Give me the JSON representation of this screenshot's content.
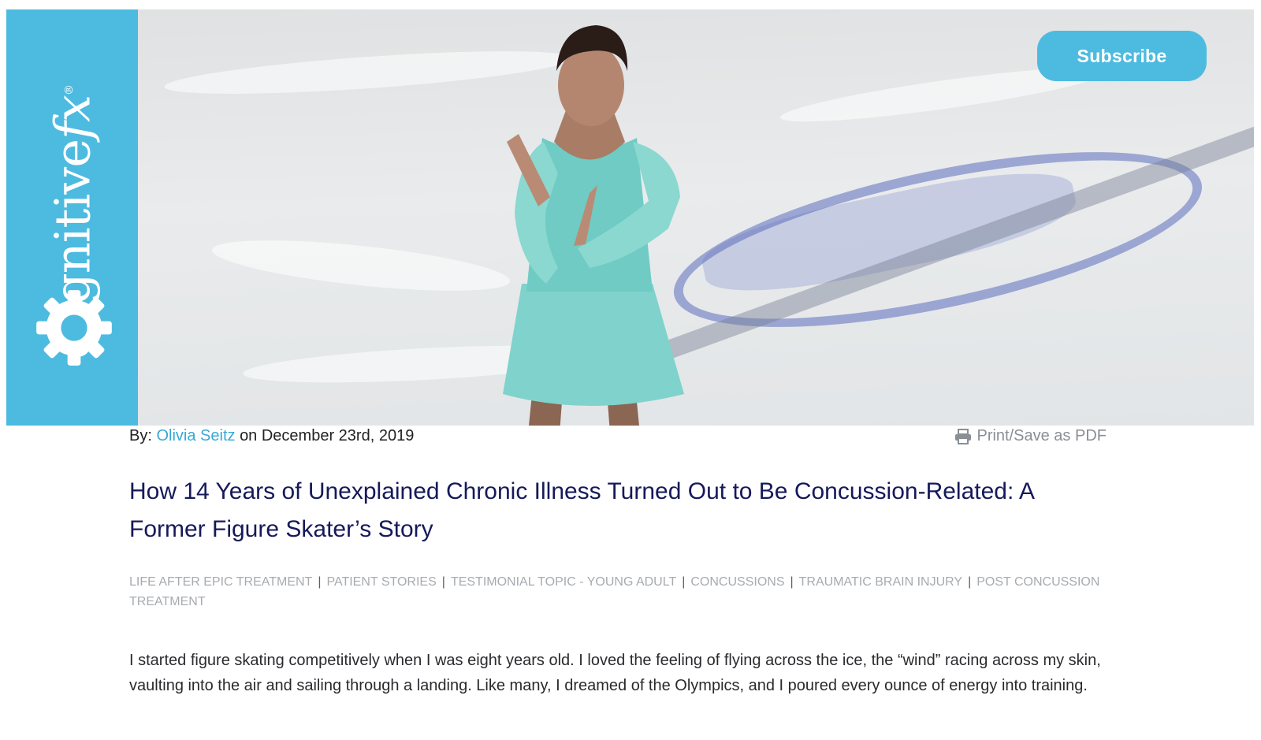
{
  "brand": {
    "logo_text_main": "cognitive",
    "logo_text_fx": "fx",
    "logo_mark": "®",
    "logo_icon": "gear-icon",
    "accent_color": "#4dbbe0",
    "title_color": "#16195a"
  },
  "header": {
    "subscribe_label": "Subscribe"
  },
  "meta": {
    "by_label": "By:",
    "author": "Olivia Seitz",
    "date_text": "on December 23rd, 2019",
    "print_label": "Print/Save as PDF",
    "print_icon": "printer-icon"
  },
  "article": {
    "title": "How 14 Years of Unexplained Chronic Illness Turned Out to Be Concussion-Related: A Former Figure Skater’s Story",
    "tags": [
      "LIFE AFTER EPIC TREATMENT",
      "PATIENT STORIES",
      "TESTIMONIAL TOPIC - YOUNG ADULT",
      "CONCUSSIONS",
      "TRAUMATIC BRAIN INJURY",
      "POST CONCUSSION TREATMENT"
    ],
    "tag_separator": "|",
    "first_paragraph": "I started figure skating competitively when I was eight years old. I loved the feeling of flying across the ice, the “wind” racing across my skin, vaulting into the air and sailing through a landing. Like many, I dreamed of the Olympics, and I poured every ounce of energy into training."
  }
}
